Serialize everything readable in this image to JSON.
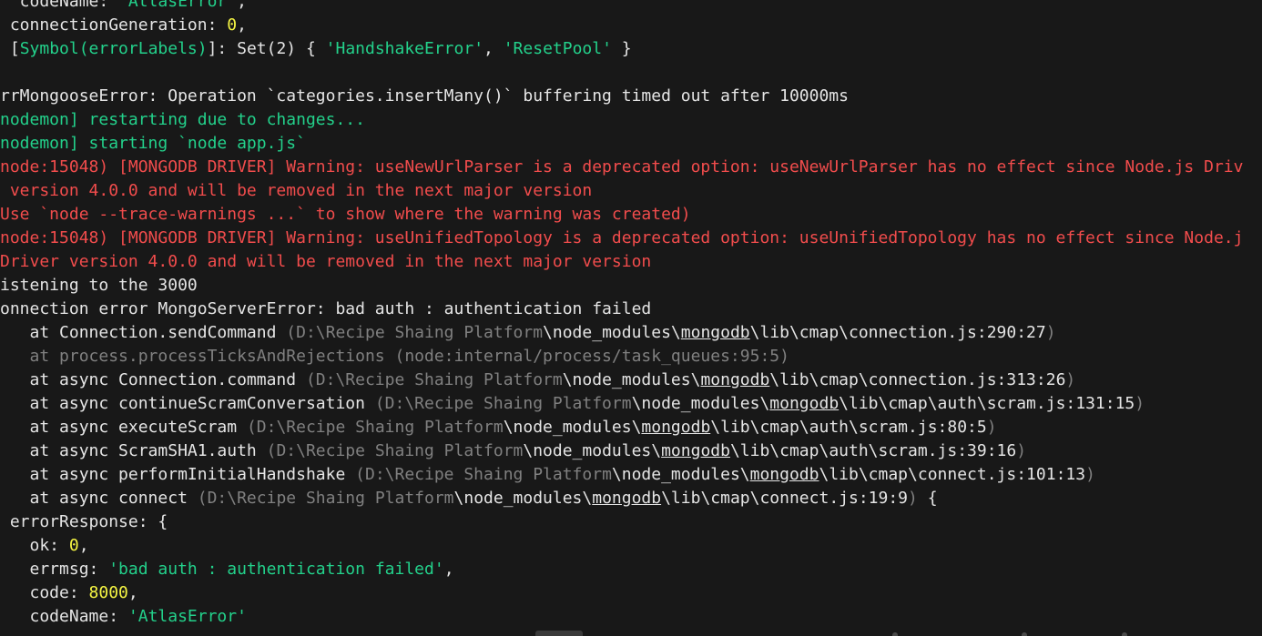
{
  "terminal": {
    "lines": [
      [
        {
          "t": "  codeName: ",
          "c": "w"
        },
        {
          "t": "'AtlasError'",
          "c": "g"
        },
        {
          "t": ",",
          "c": "w"
        }
      ],
      [
        {
          "t": " connectionGeneration: ",
          "c": "w"
        },
        {
          "t": "0",
          "c": "y"
        },
        {
          "t": ",",
          "c": "w"
        }
      ],
      [
        {
          "t": " [",
          "c": "w"
        },
        {
          "t": "Symbol(errorLabels)",
          "c": "g"
        },
        {
          "t": "]: Set(2) { ",
          "c": "w"
        },
        {
          "t": "'HandshakeError'",
          "c": "g"
        },
        {
          "t": ", ",
          "c": "w"
        },
        {
          "t": "'ResetPool'",
          "c": "g"
        },
        {
          "t": " }",
          "c": "w"
        }
      ],
      [],
      [
        {
          "t": "rrMongooseError: Operation `categories.insertMany()` buffering timed out after 10000ms",
          "c": "w"
        }
      ],
      [
        {
          "t": "nodemon] restarting due to changes...",
          "c": "g"
        }
      ],
      [
        {
          "t": "nodemon] starting `node app.js`",
          "c": "g"
        }
      ],
      [
        {
          "t": "node:15048) [MONGODB DRIVER] Warning: useNewUrlParser is a deprecated option: useNewUrlParser has no effect since Node.js Driv",
          "c": "r"
        }
      ],
      [
        {
          "t": " version 4.0.0 and will be removed in the next major version",
          "c": "r"
        }
      ],
      [
        {
          "t": "Use `node --trace-warnings ...` to show where the warning was created)",
          "c": "r"
        }
      ],
      [
        {
          "t": "node:15048) [MONGODB DRIVER] Warning: useUnifiedTopology is a deprecated option: useUnifiedTopology has no effect since Node.j",
          "c": "r"
        }
      ],
      [
        {
          "t": "Driver version 4.0.0 and will be removed in the next major version",
          "c": "r"
        }
      ],
      [
        {
          "t": "istening to the 3000",
          "c": "w"
        }
      ],
      [
        {
          "t": "onnection error MongoServerError: bad auth : authentication failed",
          "c": "w"
        }
      ],
      [
        {
          "t": "   at Connection.sendCommand ",
          "c": "w"
        },
        {
          "t": "(D:\\Recipe Shaing Platform",
          "c": "d"
        },
        {
          "t": "\\node_modules\\",
          "c": "w"
        },
        {
          "t": "mongodb",
          "c": "w u"
        },
        {
          "t": "\\lib\\cmap\\connection.js:290:27",
          "c": "w"
        },
        {
          "t": ")",
          "c": "d"
        }
      ],
      [
        {
          "t": "   at process.processTicksAndRejections (node:internal/process/task_queues:95:5)",
          "c": "d"
        }
      ],
      [
        {
          "t": "   at async Connection.command ",
          "c": "w"
        },
        {
          "t": "(D:\\Recipe Shaing Platform",
          "c": "d"
        },
        {
          "t": "\\node_modules\\",
          "c": "w"
        },
        {
          "t": "mongodb",
          "c": "w u"
        },
        {
          "t": "\\lib\\cmap\\connection.js:313:26",
          "c": "w"
        },
        {
          "t": ")",
          "c": "d"
        }
      ],
      [
        {
          "t": "   at async continueScramConversation ",
          "c": "w"
        },
        {
          "t": "(D:\\Recipe Shaing Platform",
          "c": "d"
        },
        {
          "t": "\\node_modules\\",
          "c": "w"
        },
        {
          "t": "mongodb",
          "c": "w u"
        },
        {
          "t": "\\lib\\cmap\\auth\\scram.js:131:15",
          "c": "w"
        },
        {
          "t": ")",
          "c": "d"
        }
      ],
      [
        {
          "t": "   at async executeScram ",
          "c": "w"
        },
        {
          "t": "(D:\\Recipe Shaing Platform",
          "c": "d"
        },
        {
          "t": "\\node_modules\\",
          "c": "w"
        },
        {
          "t": "mongodb",
          "c": "w u"
        },
        {
          "t": "\\lib\\cmap\\auth\\scram.js:80:5",
          "c": "w"
        },
        {
          "t": ")",
          "c": "d"
        }
      ],
      [
        {
          "t": "   at async ScramSHA1.auth ",
          "c": "w"
        },
        {
          "t": "(D:\\Recipe Shaing Platform",
          "c": "d"
        },
        {
          "t": "\\node_modules\\",
          "c": "w"
        },
        {
          "t": "mongodb",
          "c": "w u"
        },
        {
          "t": "\\lib\\cmap\\auth\\scram.js:39:16",
          "c": "w"
        },
        {
          "t": ")",
          "c": "d"
        }
      ],
      [
        {
          "t": "   at async performInitialHandshake ",
          "c": "w"
        },
        {
          "t": "(D:\\Recipe Shaing Platform",
          "c": "d"
        },
        {
          "t": "\\node_modules\\",
          "c": "w"
        },
        {
          "t": "mongodb",
          "c": "w u"
        },
        {
          "t": "\\lib\\cmap\\connect.js:101:13",
          "c": "w"
        },
        {
          "t": ")",
          "c": "d"
        }
      ],
      [
        {
          "t": "   at async connect ",
          "c": "w"
        },
        {
          "t": "(D:\\Recipe Shaing Platform",
          "c": "d"
        },
        {
          "t": "\\node_modules\\",
          "c": "w"
        },
        {
          "t": "mongodb",
          "c": "w u"
        },
        {
          "t": "\\lib\\cmap\\connect.js:19:9",
          "c": "w"
        },
        {
          "t": ")",
          "c": "d"
        },
        {
          "t": " {",
          "c": "w"
        }
      ],
      [
        {
          "t": " errorResponse: {",
          "c": "w"
        }
      ],
      [
        {
          "t": "   ok: ",
          "c": "w"
        },
        {
          "t": "0",
          "c": "y"
        },
        {
          "t": ",",
          "c": "w"
        }
      ],
      [
        {
          "t": "   errmsg: ",
          "c": "w"
        },
        {
          "t": "'bad auth : authentication failed'",
          "c": "g"
        },
        {
          "t": ",",
          "c": "w"
        }
      ],
      [
        {
          "t": "   code: ",
          "c": "w"
        },
        {
          "t": "8000",
          "c": "y"
        },
        {
          "t": ",",
          "c": "w"
        }
      ],
      [
        {
          "t": "   codeName: ",
          "c": "w"
        },
        {
          "t": "'AtlasError'",
          "c": "g"
        }
      ]
    ]
  },
  "colors": {
    "background": "#181818",
    "text": "#e5e5e5",
    "green": "#23d18b",
    "red": "#f14c4c",
    "yellow": "#f5f543",
    "dim": "#808080"
  }
}
